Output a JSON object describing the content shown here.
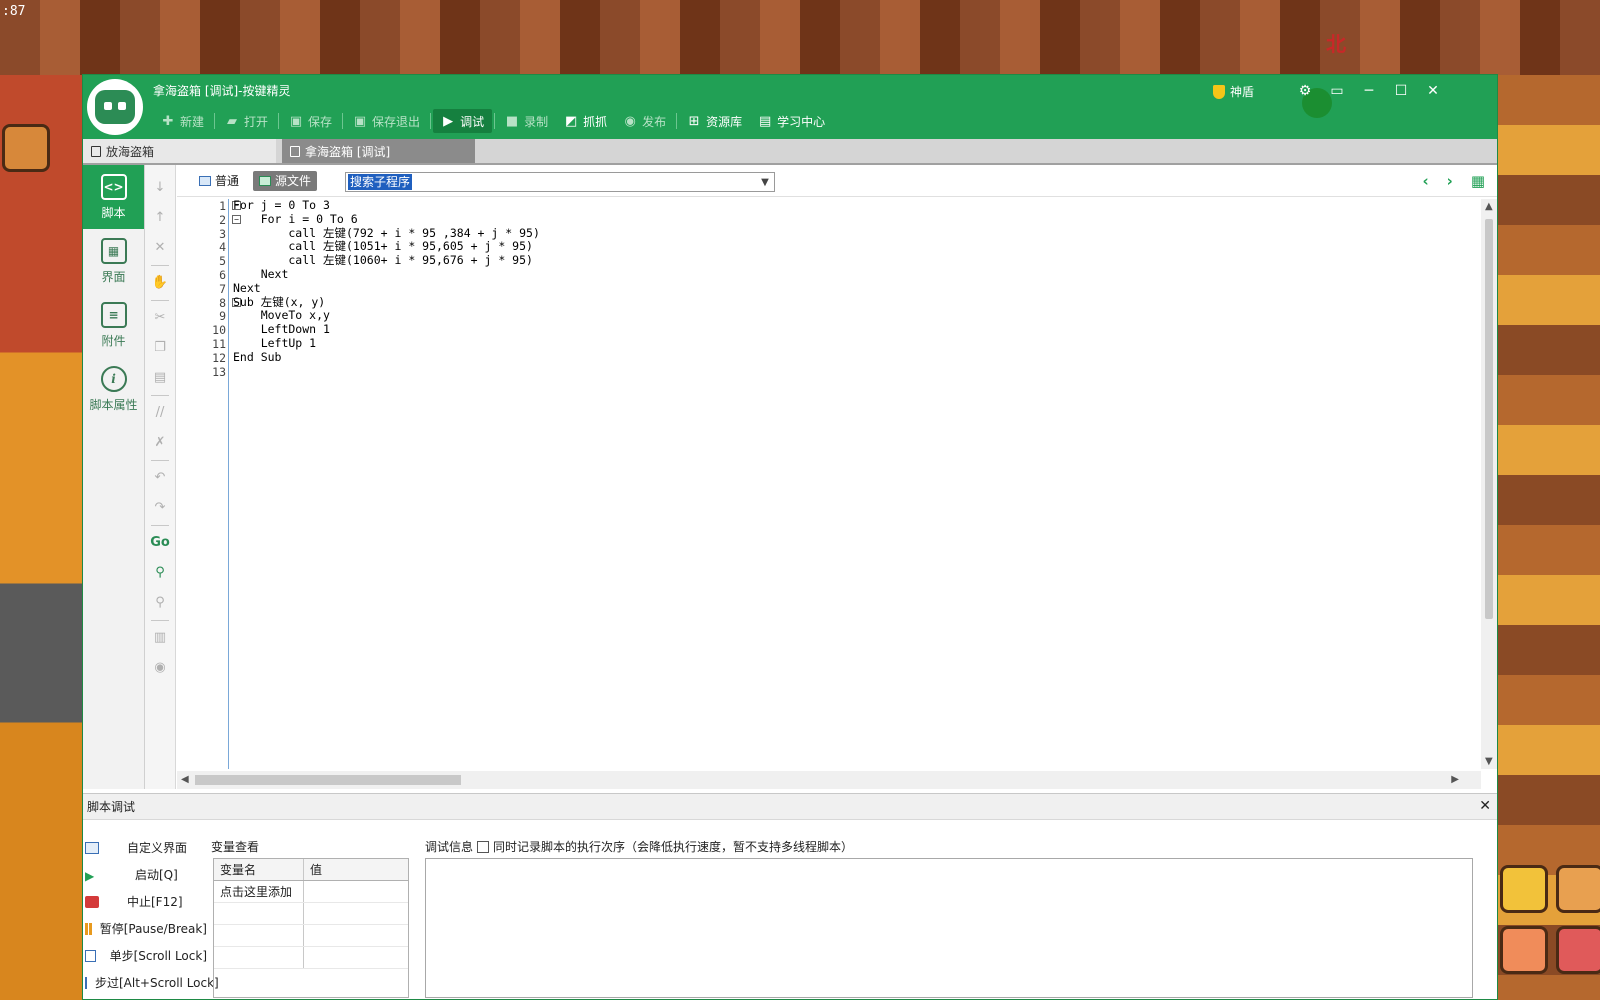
{
  "background": {
    "clock": ":87",
    "compass": "北"
  },
  "window": {
    "title": "拿海盗箱 [调试]-按键精灵",
    "shield_label": "神盾",
    "controls": {
      "settings": "⚙",
      "restore_menu": "▭",
      "minimize": "─",
      "maximize": "☐",
      "close": "✕"
    }
  },
  "toolbar": {
    "new": "新建",
    "open": "打开",
    "save": "保存",
    "save_exit": "保存退出",
    "debug": "调试",
    "record": "录制",
    "capture": "抓抓",
    "publish": "发布",
    "resources": "资源库",
    "learning": "学习中心"
  },
  "tabs": [
    {
      "label": "放海盗箱"
    },
    {
      "label": "拿海盗箱 [调试]"
    }
  ],
  "sidenav": [
    {
      "label": "脚本",
      "glyph": "<>"
    },
    {
      "label": "界面",
      "glyph": "▦"
    },
    {
      "label": "附件",
      "glyph": "≡"
    },
    {
      "label": "脚本属性",
      "glyph": "i"
    }
  ],
  "editor": {
    "mode_normal": "普通",
    "mode_source": "源文件",
    "search_placeholder": "搜索子程序",
    "lines": [
      "For j = 0 To 3",
      "    For i = 0 To 6",
      "        call 左键(792 + i * 95 ,384 + j * 95)",
      "        call 左键(1051+ i * 95,605 + j * 95)",
      "        call 左键(1060+ i * 95,676 + j * 95)",
      "    Next",
      "Next",
      "Sub 左键(x, y)",
      "    MoveTo x,y",
      "    LeftDown 1",
      "    LeftUp 1",
      "End Sub",
      ""
    ],
    "line_numbers": [
      "1",
      "2",
      "3",
      "4",
      "5",
      "6",
      "7",
      "8",
      "9",
      "10",
      "11",
      "12",
      "13"
    ]
  },
  "debug_panel": {
    "title": "脚本调试",
    "buttons": {
      "custom_ui": "自定义界面",
      "start": "启动[Q]",
      "stop": "中止[F12]",
      "pause": "暂停[Pause/Break]",
      "step": "单步[Scroll Lock]",
      "step_over": "步过[Alt+Scroll Lock]"
    },
    "var_view_title": "变量查看",
    "var_col_name": "变量名",
    "var_col_value": "值",
    "var_add": "点击这里添加",
    "info_title": "调试信息",
    "record_order_label": "同时记录脚本的执行次序（会降低执行速度，暂不支持多线程脚本）"
  },
  "colors": {
    "accent": "#21a055",
    "selection": "#1f5fbf"
  }
}
